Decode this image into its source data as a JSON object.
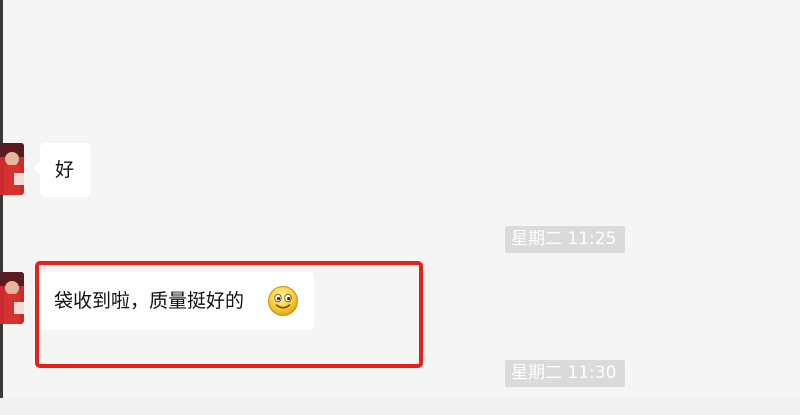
{
  "chat": {
    "messages": [
      {
        "sender": "contact",
        "text": "好",
        "emoji": null
      },
      {
        "sender": "contact",
        "text": "袋收到啦，质量挺好的",
        "emoji": "smile-emoji"
      }
    ],
    "timestamps": [
      "星期二 11:25",
      "星期二 11:30"
    ]
  },
  "colors": {
    "background": "#f5f5f5",
    "bubble": "#ffffff",
    "timestamp_bg": "#dadada",
    "timestamp_text": "#ffffff",
    "highlight": "#e6211b"
  },
  "icons": {
    "avatar": "avatar-image",
    "emoji": "smile-emoji-icon"
  }
}
